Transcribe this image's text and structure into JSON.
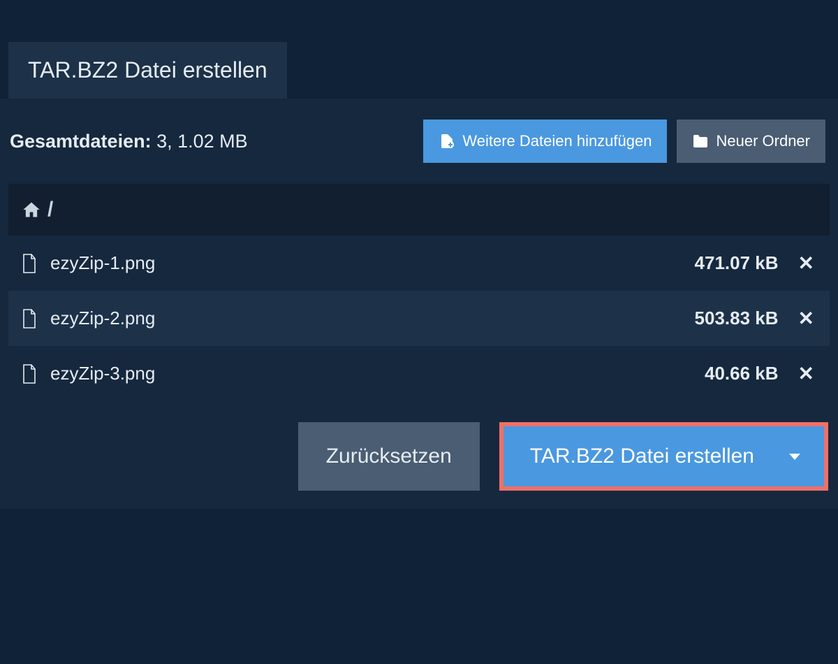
{
  "tab": {
    "title": "TAR.BZ2 Datei erstellen"
  },
  "summary": {
    "label": "Gesamtdateien:",
    "stats": "3, 1.02 MB"
  },
  "toolbar": {
    "add_files_label": "Weitere Dateien hinzufügen",
    "new_folder_label": "Neuer Ordner"
  },
  "breadcrumb": {
    "path": "/"
  },
  "files": [
    {
      "name": "ezyZip-1.png",
      "size": "471.07 kB"
    },
    {
      "name": "ezyZip-2.png",
      "size": "503.83 kB"
    },
    {
      "name": "ezyZip-3.png",
      "size": "40.66 kB"
    }
  ],
  "footer": {
    "reset_label": "Zurücksetzen",
    "create_label": "TAR.BZ2 Datei erstellen"
  },
  "colors": {
    "accent": "#4a98e0",
    "highlight_border": "#f07066",
    "secondary": "#4a5d73",
    "bg_deep": "#0f2237",
    "bg_panel": "#16283e"
  }
}
